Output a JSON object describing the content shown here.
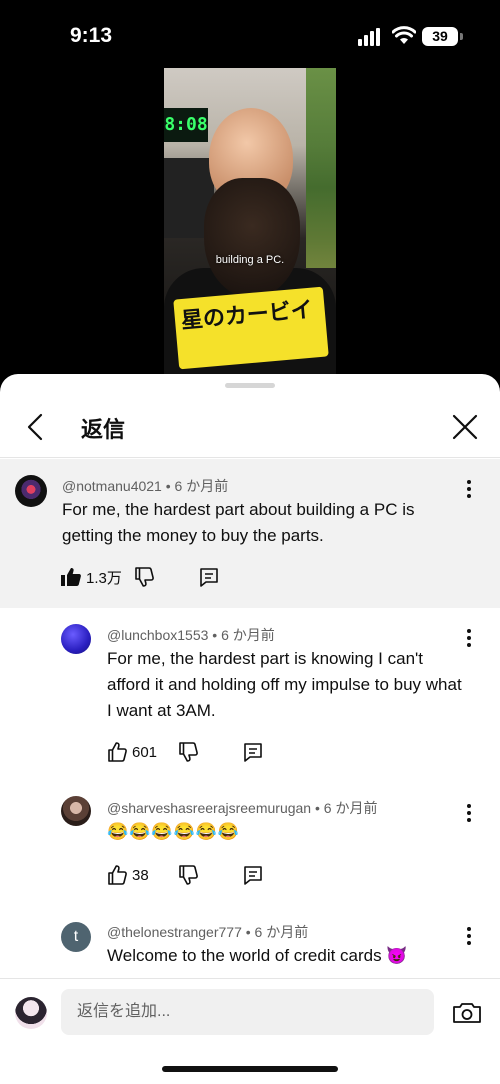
{
  "status_bar": {
    "time": "9:13",
    "battery": "39"
  },
  "video": {
    "caption": "building a PC.",
    "shirt_text": "星のカービイ"
  },
  "sheet": {
    "title": "返信"
  },
  "parent_comment": {
    "author": "@notmanu4021",
    "age": "6 か月前",
    "text": "For me, the hardest part about building a PC is getting the money to buy the parts.",
    "likes": "1.3万"
  },
  "replies": [
    {
      "author": "@lunchbox1553",
      "age": "6 か月前",
      "text": "For me, the hardest part is knowing I can't afford it and holding off my impulse to buy what I want at 3AM.",
      "likes": "601"
    },
    {
      "author": "@sharveshasreerajsreemurugan",
      "age": "6 か月前",
      "text": "😂😂😂😂😂😂",
      "likes": "38"
    },
    {
      "author": "@thelonestranger777",
      "age": "6 か月前",
      "text": "Welcome to the world of credit cards 😈",
      "avatar_letter": "t"
    }
  ],
  "input": {
    "placeholder": "返信を追加..."
  },
  "colors": {
    "accent_dark": "#0f0f0f",
    "meta_gray": "#606060",
    "highlight_bg": "#f2f2f2"
  }
}
